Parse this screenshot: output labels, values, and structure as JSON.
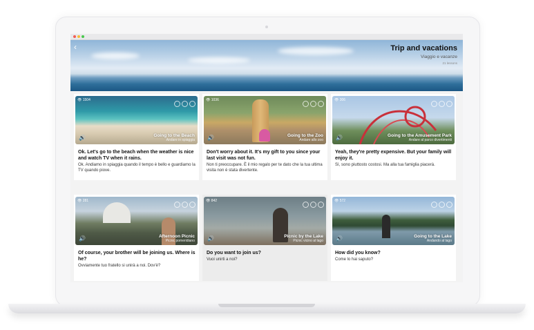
{
  "header": {
    "title": "Trip and vacations",
    "subtitle": "Viaggio e vacanze",
    "count": "21 lessons"
  },
  "cards": [
    {
      "views": "1504",
      "title": "Going to the Beach",
      "title_it": "Andare in spiaggia",
      "question": "Ok. Let's go to the beach when the weather is nice and watch TV when it rains.",
      "answer": "Ok. Andiamo in spiaggia quando il tempo è bello e guardiamo la TV quando piove."
    },
    {
      "views": "1036",
      "title": "Going to the Zoo",
      "title_it": "Andare allo zoo",
      "question": "Don't worry about it. It's my gift to you since your last visit was not fun.",
      "answer": "Non ti preoccupare. È il mio regalo per te dato che la tua ultima visita non è stata divertente."
    },
    {
      "views": "306",
      "title": "Going to the Amusement Park",
      "title_it": "Andare al parco divertimenti",
      "question": "Yeah, they're pretty expensive. But your family will enjoy it.",
      "answer": "Sì, sono piuttosto costosi. Ma alla tua famiglia piacerà."
    },
    {
      "views": "281",
      "title": "Afternoon Picnic",
      "title_it": "Picnic pomeridiano",
      "question": "Of course, your brother will be joining us. Where is he?",
      "answer": "Ovviamente tuo fratello si unirà a noi. Dov'è?"
    },
    {
      "views": "842",
      "title": "Picnic by the Lake",
      "title_it": "Picnic vicino al lago",
      "question": "Do you want to join us?",
      "answer": "Vuoi unirti a noi?"
    },
    {
      "views": "572",
      "title": "Going to the Lake",
      "title_it": "Andando al lago",
      "question": "How did you know?",
      "answer": "Come lo hai saputo?"
    }
  ]
}
